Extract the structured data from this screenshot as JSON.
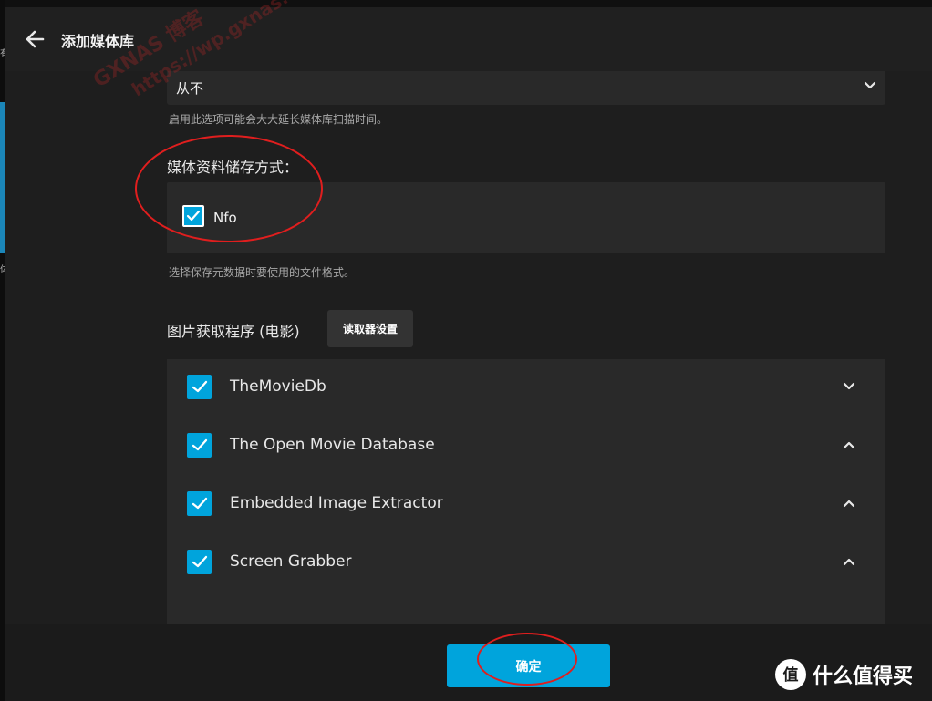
{
  "dialog": {
    "title": "添加媒体库"
  },
  "metadata_refresh": {
    "selected": "从不",
    "help": "启用此选项可能会大大延长媒体库扫描时间。"
  },
  "storage": {
    "label": "媒体资料储存方式：",
    "options": [
      {
        "label": "Nfo",
        "checked": true
      }
    ],
    "help": "选择保存元数据时要使用的文件格式。"
  },
  "image_fetchers": {
    "label": "图片获取程序 (电影)",
    "settings_button": "读取器设置",
    "items": [
      {
        "label": "TheMovieDb",
        "checked": true,
        "arrow": "chevron-down-icon"
      },
      {
        "label": "The Open Movie Database",
        "checked": true,
        "arrow": "chevron-up-icon"
      },
      {
        "label": "Embedded Image Extractor",
        "checked": true,
        "arrow": "chevron-up-icon"
      },
      {
        "label": "Screen Grabber",
        "checked": true,
        "arrow": "chevron-up-icon"
      }
    ]
  },
  "footer": {
    "ok_label": "确定"
  },
  "background": {
    "left_glyph_1": "有",
    "left_glyph_2": "体"
  },
  "watermark": {
    "line1": "GXNAS 博客",
    "line2": "https://wp.gxnas.com"
  },
  "site_logo": {
    "icon_glyph": "值",
    "text": "什么值得买"
  },
  "colors": {
    "accent": "#00a4dc",
    "annotation": "#e01e1e",
    "dialog_bg": "#1e1e1e",
    "panel_bg": "#292929"
  }
}
